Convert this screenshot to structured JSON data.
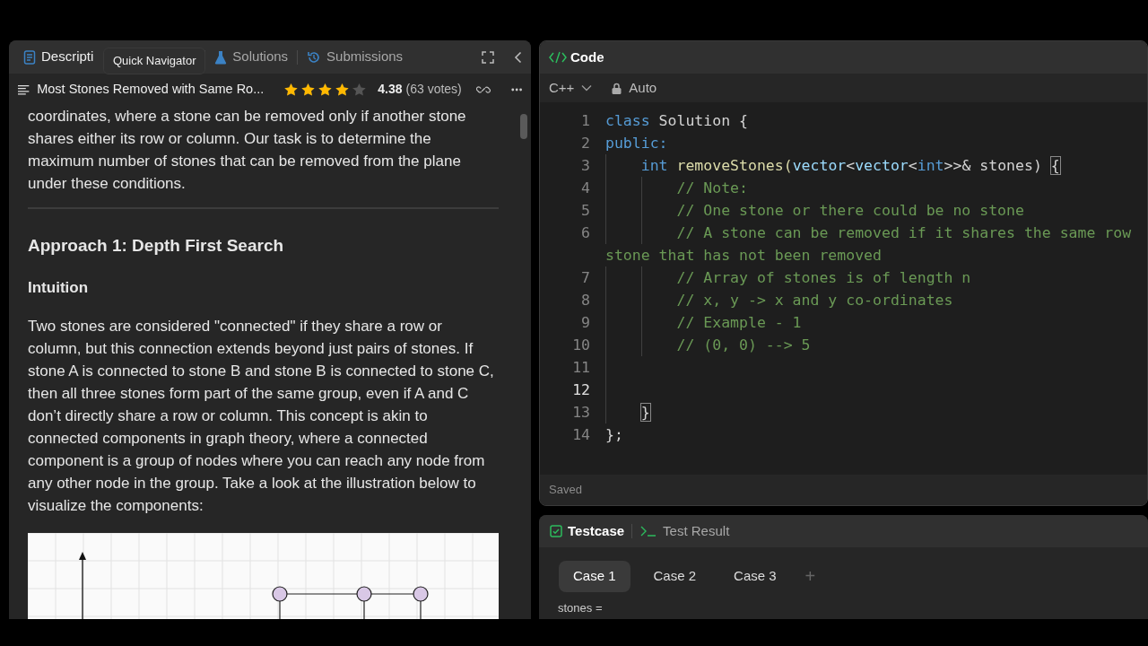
{
  "left_panel": {
    "tabs": [
      {
        "label": "Descripti",
        "selected": true
      },
      {
        "label": "Solutions",
        "selected": false
      },
      {
        "label": "Submissions",
        "selected": false
      }
    ],
    "tooltip": "Quick Navigator",
    "problem_title": "Most Stones Removed with Same Ro...",
    "rating": {
      "stars": 4,
      "score": "4.38",
      "votes": "(63 votes)"
    },
    "content": [
      {
        "kind": "paragraph",
        "text": "coordinates, where a stone can be removed only if another stone shares either its row or column. Our task is to determine the maximum number of stones that can be removed from the plane under these conditions."
      },
      {
        "kind": "rule"
      },
      {
        "kind": "heading",
        "text": "Approach 1: Depth First Search"
      },
      {
        "kind": "subheading",
        "text": "Intuition"
      },
      {
        "kind": "paragraph",
        "text": "Two stones are considered \"connected\" if they share a row or column, but this connection extends beyond just pairs of stones. If stone A is connected to stone B and stone B is connected to stone C, then all three stones form part of the same group, even if A and C don’t directly share a row or column. This concept is akin to connected components in graph theory, where a connected component is a group of nodes where you can reach any node from any other node in the group. Take a look at the illustration below to visualize the components:"
      },
      {
        "kind": "illustration"
      }
    ]
  },
  "code_panel": {
    "title": "Code",
    "language": "C++",
    "mode": "Auto",
    "status": "Saved",
    "lines": [
      {
        "number": "1",
        "current": false,
        "tokens": [
          {
            "text": "class ",
            "kind": "keyword"
          },
          {
            "text": "Solution {",
            "kind": "plain"
          }
        ]
      },
      {
        "number": "2",
        "current": false,
        "tokens": [
          {
            "text": "public:",
            "kind": "keyword"
          }
        ]
      },
      {
        "number": "3",
        "current": false,
        "tokens": [
          {
            "text": "    int ",
            "kind": "keyword"
          },
          {
            "text": "removeStones(",
            "kind": "function"
          },
          {
            "text": "vector",
            "kind": "type"
          },
          {
            "text": "<",
            "kind": "plain"
          },
          {
            "text": "vector",
            "kind": "type"
          },
          {
            "text": "<",
            "kind": "plain"
          },
          {
            "text": "int",
            "kind": "keyword"
          },
          {
            "text": ">>& stones) ",
            "kind": "plain"
          },
          {
            "text": "{",
            "kind": "bracket-match"
          }
        ]
      },
      {
        "number": "4",
        "current": false,
        "tokens": [
          {
            "text": "        // Note:",
            "kind": "comment"
          }
        ]
      },
      {
        "number": "5",
        "current": false,
        "tokens": [
          {
            "text": "        // One stone or there could be no stone",
            "kind": "comment"
          }
        ]
      },
      {
        "number": "6",
        "current": false,
        "tokens": [
          {
            "text": "        // A stone can be removed if it shares the same row",
            "kind": "comment"
          }
        ],
        "continuation": "stone that has not been removed"
      },
      {
        "number": "7",
        "current": false,
        "tokens": [
          {
            "text": "        // Array of stones is of length n",
            "kind": "comment"
          }
        ]
      },
      {
        "number": "8",
        "current": false,
        "tokens": [
          {
            "text": "        // x, y -> x and y co-ordinates",
            "kind": "comment"
          }
        ]
      },
      {
        "number": "9",
        "current": false,
        "tokens": [
          {
            "text": "        // Example - 1",
            "kind": "comment"
          }
        ]
      },
      {
        "number": "10",
        "current": false,
        "tokens": [
          {
            "text": "        // (0, 0) --> 5",
            "kind": "comment"
          }
        ]
      },
      {
        "number": "11",
        "current": false
      },
      {
        "number": "12",
        "current": true
      },
      {
        "number": "13",
        "current": false,
        "tokens": [
          {
            "text": "    }",
            "kind": "bracket-match"
          }
        ]
      },
      {
        "number": "14",
        "current": false,
        "tokens": [
          {
            "text": "};",
            "kind": "plain"
          }
        ]
      }
    ]
  },
  "test_panel": {
    "tabs": [
      {
        "label": "Testcase",
        "selected": true
      },
      {
        "label": "Test Result",
        "selected": false
      }
    ],
    "cases": [
      {
        "label": "Case 1",
        "selected": true
      },
      {
        "label": "Case 2",
        "selected": false
      },
      {
        "label": "Case 3",
        "selected": false
      }
    ],
    "add_label": "+",
    "input_label": "stones ="
  }
}
